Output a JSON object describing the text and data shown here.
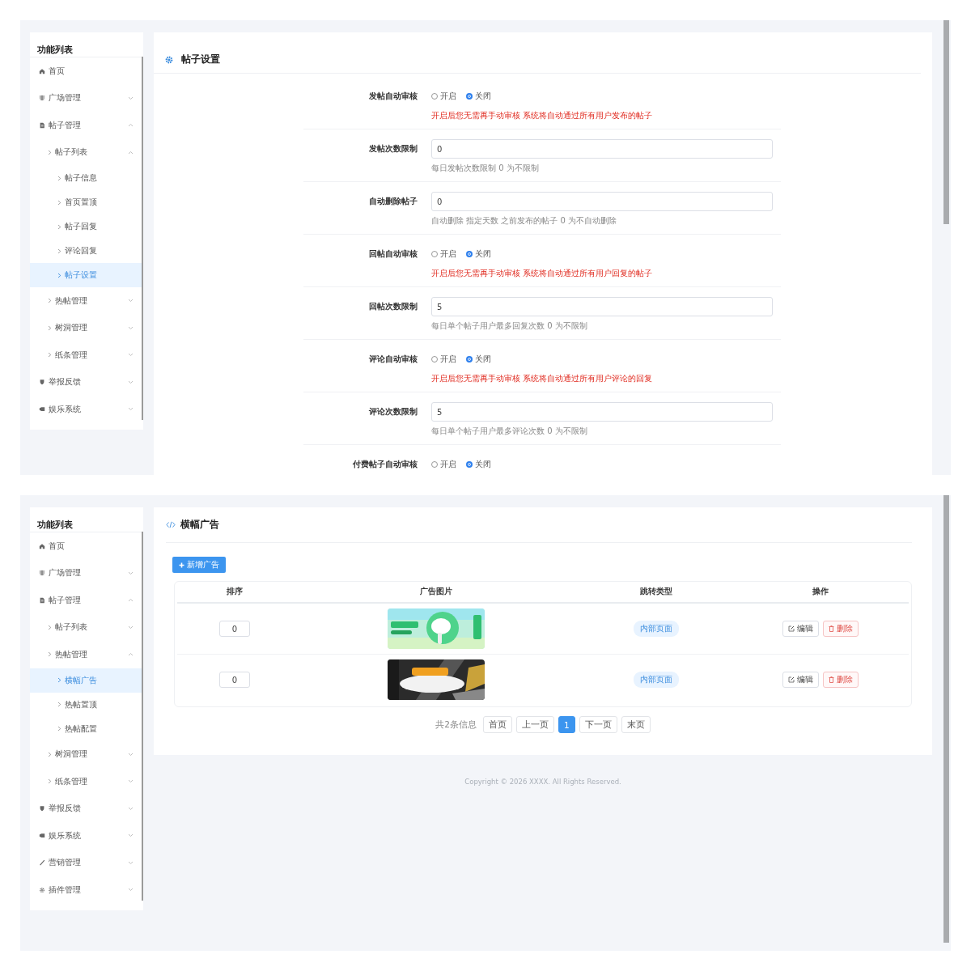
{
  "top_screen": {
    "sidebar": {
      "title": "功能列表",
      "items": [
        {
          "label": "首页",
          "selected": false
        },
        {
          "label": "广场管理",
          "expanded": false,
          "selected": false
        },
        {
          "label": "帖子管理",
          "expanded": true,
          "selected": false,
          "children": [
            {
              "label": "帖子列表",
              "expanded": true,
              "selected": false,
              "children": [
                {
                  "label": "帖子信息",
                  "selected": false
                },
                {
                  "label": "首页置顶",
                  "selected": false
                },
                {
                  "label": "帖子回复",
                  "selected": false
                },
                {
                  "label": "评论回复",
                  "selected": false
                },
                {
                  "label": "帖子设置",
                  "selected": true
                }
              ]
            },
            {
              "label": "热帖管理",
              "expanded": false,
              "selected": false
            },
            {
              "label": "树洞管理",
              "expanded": false,
              "selected": false
            },
            {
              "label": "纸条管理",
              "expanded": false,
              "selected": false
            }
          ]
        },
        {
          "label": "举报反馈",
          "expanded": false,
          "selected": false
        },
        {
          "label": "娱乐系统",
          "expanded": false,
          "selected": false
        }
      ]
    },
    "page_title": "帖子设置",
    "settings": [
      {
        "kind": "radio",
        "label": "发帖自动审核",
        "options": [
          {
            "label": "开启",
            "selected": false
          },
          {
            "label": "关闭",
            "selected": true
          }
        ],
        "hint": "开启后您无需再手动审核 系统将自动通过所有用户发布的帖子"
      },
      {
        "kind": "input",
        "label": "发帖次数限制",
        "value": "0",
        "hint": "每日发帖次数限制 0 为不限制"
      },
      {
        "kind": "input",
        "label": "自动删除帖子",
        "value": "0",
        "hint": "自动删除 指定天数 之前发布的帖子 0 为不自动删除"
      },
      {
        "kind": "radio",
        "label": "回帖自动审核",
        "options": [
          {
            "label": "开启",
            "selected": false
          },
          {
            "label": "关闭",
            "selected": true
          }
        ],
        "hint": "开启后您无需再手动审核 系统将自动通过所有用户回复的帖子"
      },
      {
        "kind": "input",
        "label": "回帖次数限制",
        "value": "5",
        "hint": "每日单个帖子用户最多回复次数 0 为不限制"
      },
      {
        "kind": "radio",
        "label": "评论自动审核",
        "options": [
          {
            "label": "开启",
            "selected": false
          },
          {
            "label": "关闭",
            "selected": true
          }
        ],
        "hint": "开启后您无需再手动审核 系统将自动通过所有用户评论的回复"
      },
      {
        "kind": "input",
        "label": "评论次数限制",
        "value": "5",
        "hint": "每日单个帖子用户最多评论次数 0 为不限制"
      },
      {
        "kind": "radio",
        "label": "付费帖子自动审核",
        "options": [
          {
            "label": "开启",
            "selected": false
          },
          {
            "label": "关闭",
            "selected": true
          }
        ]
      }
    ]
  },
  "bottom_screen": {
    "sidebar": {
      "title": "功能列表",
      "items": [
        {
          "label": "首页",
          "selected": false
        },
        {
          "label": "广场管理",
          "expanded": false,
          "selected": false
        },
        {
          "label": "帖子管理",
          "expanded": true,
          "selected": false,
          "children": [
            {
              "label": "帖子列表",
              "expanded": false,
              "selected": false
            },
            {
              "label": "热帖管理",
              "expanded": true,
              "selected": false,
              "children": [
                {
                  "label": "横幅广告",
                  "selected": true
                },
                {
                  "label": "热帖置顶",
                  "selected": false
                },
                {
                  "label": "热帖配置",
                  "selected": false
                }
              ]
            },
            {
              "label": "树洞管理",
              "expanded": false,
              "selected": false
            },
            {
              "label": "纸条管理",
              "expanded": false,
              "selected": false
            }
          ]
        },
        {
          "label": "举报反馈",
          "expanded": false,
          "selected": false
        },
        {
          "label": "娱乐系统",
          "expanded": false,
          "selected": false
        },
        {
          "label": "营销管理",
          "expanded": false,
          "selected": false
        },
        {
          "label": "插件管理",
          "expanded": false,
          "selected": false
        }
      ]
    },
    "page_title": "横幅广告",
    "add_button": "新增广告",
    "table": {
      "columns": [
        "排序",
        "广告图片",
        "跳转类型",
        "操作"
      ],
      "rows": [
        {
          "sort": "0",
          "picture": {
            "kind": "picture"
          },
          "jump_type": "内部页面",
          "actions": [
            "编辑",
            "删除"
          ]
        },
        {
          "sort": "0",
          "picture": {
            "kind": "picture"
          },
          "jump_type": "内部页面",
          "actions": [
            "编辑",
            "删除"
          ]
        }
      ]
    },
    "pagination": {
      "summary": "共2条信息",
      "first": "首页",
      "prev": "上一页",
      "pages": [
        {
          "label": "1",
          "selected": true
        }
      ],
      "next": "下一页",
      "last": "末页"
    },
    "footer": "Copyright © 2026 XXXX. All Rights Reserved."
  }
}
